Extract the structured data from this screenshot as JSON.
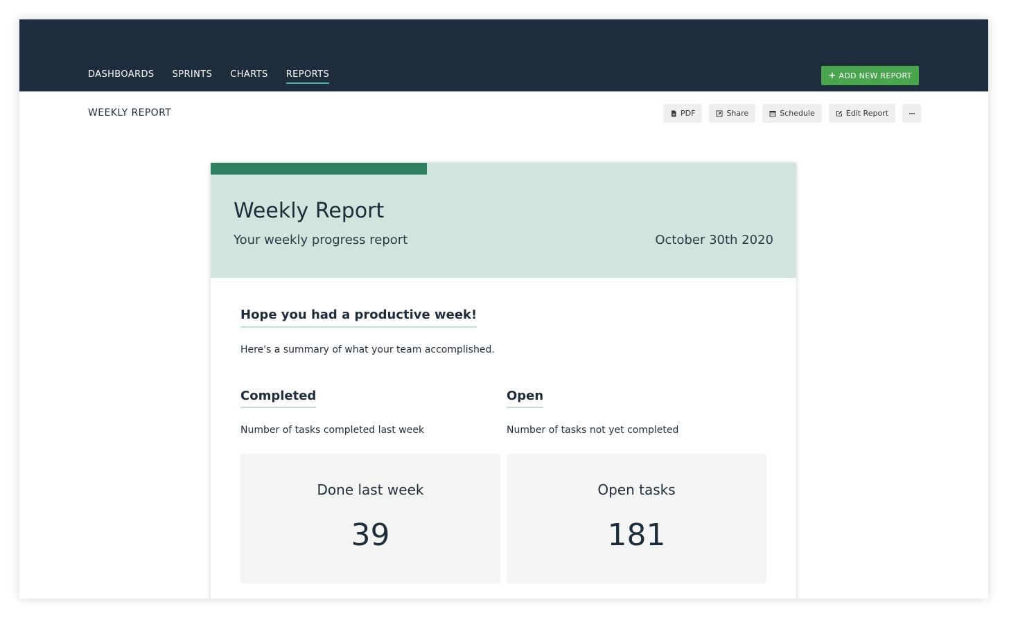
{
  "nav": {
    "items": [
      {
        "label": "DASHBOARDS",
        "active": false
      },
      {
        "label": "SPRINTS",
        "active": false
      },
      {
        "label": "CHARTS",
        "active": false
      },
      {
        "label": "REPORTS",
        "active": true
      }
    ],
    "add_button": {
      "icon": "plus-icon",
      "label": "ADD NEW REPORT"
    }
  },
  "page": {
    "title": "WEEKLY REPORT"
  },
  "toolbar": {
    "pdf": {
      "icon": "pdf-file-icon",
      "label": "PDF"
    },
    "share": {
      "icon": "share-icon",
      "label": "Share"
    },
    "schedule": {
      "icon": "calendar-icon",
      "label": "Schedule"
    },
    "edit": {
      "icon": "edit-icon",
      "label": "Edit Report"
    },
    "more": {
      "icon": "ellipsis-icon"
    }
  },
  "report": {
    "title": "Weekly Report",
    "subtitle": "Your weekly progress report",
    "date": "October 30th 2020",
    "progress_fraction": 0.369,
    "greeting": "Hope you had a productive week!",
    "summary": "Here's a summary of what your team accomplished.",
    "completed": {
      "title": "Completed",
      "description": "Number of tasks completed last week",
      "stat_label": "Done last week",
      "stat_value": "39"
    },
    "open": {
      "title": "Open",
      "description": "Number of tasks not yet completed",
      "stat_label": "Open tasks",
      "stat_value": "181"
    }
  },
  "colors": {
    "topbar": "#1e2d3b",
    "accent_green": "#4aa54f",
    "header_tint": "#cfe5dd",
    "progress": "#2f8061"
  }
}
